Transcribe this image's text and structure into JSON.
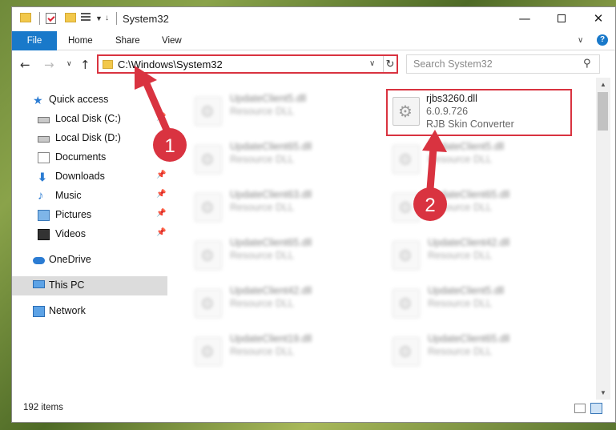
{
  "window": {
    "title": "System32",
    "min_glyph": "—",
    "close_glyph": "✕"
  },
  "ribbon": {
    "tabs": [
      "File",
      "Home",
      "Share",
      "View"
    ],
    "help_glyph": "?"
  },
  "navigation": {
    "address": "C:\\Windows\\System32",
    "search_placeholder": "Search System32",
    "back_glyph": "←",
    "forward_glyph": "→",
    "up_glyph": "↑",
    "refresh_glyph": "↻"
  },
  "sidebar": {
    "quick_access": "Quick access",
    "items": [
      {
        "label": "Local Disk (C:)",
        "pinned": true
      },
      {
        "label": "Local Disk (D:)",
        "pinned": false
      },
      {
        "label": "Documents",
        "pinned": false
      },
      {
        "label": "Downloads",
        "pinned": true
      },
      {
        "label": "Music",
        "pinned": true
      },
      {
        "label": "Pictures",
        "pinned": true
      },
      {
        "label": "Videos",
        "pinned": true
      }
    ],
    "onedrive": "OneDrive",
    "this_pc": "This PC",
    "network": "Network"
  },
  "files": {
    "highlighted": {
      "name": "rjbs3260.dll",
      "version": "6.0.9.726",
      "description": "RJB Skin Converter"
    },
    "left_column": [
      {
        "name": "UpdateClient5.dll",
        "type": "Resource DLL"
      },
      {
        "name": "UpdateClient65.dll",
        "type": "Resource DLL"
      },
      {
        "name": "UpdateClient63.dll",
        "type": "Resource DLL"
      },
      {
        "name": "UpdateClient65.dll",
        "type": "Resource DLL"
      },
      {
        "name": "UpdateClient42.dll",
        "type": "Resource DLL"
      },
      {
        "name": "UpdateClient19.dll",
        "type": "Resource DLL"
      }
    ],
    "right_column": [
      {
        "name": "UpdateClient5.dll",
        "type": "Resource DLL"
      },
      {
        "name": "UpdateClient65.dll",
        "type": "Resource DLL"
      },
      {
        "name": "UpdateClient42.dll",
        "type": "Resource DLL"
      },
      {
        "name": "UpdateClient5.dll",
        "type": "Resource DLL"
      },
      {
        "name": "UpdateClient65.dll",
        "type": "Resource DLL"
      }
    ]
  },
  "status": {
    "item_count": "192 items"
  },
  "annotations": {
    "badge_1": "1",
    "badge_2": "2",
    "color": "#d93340"
  }
}
